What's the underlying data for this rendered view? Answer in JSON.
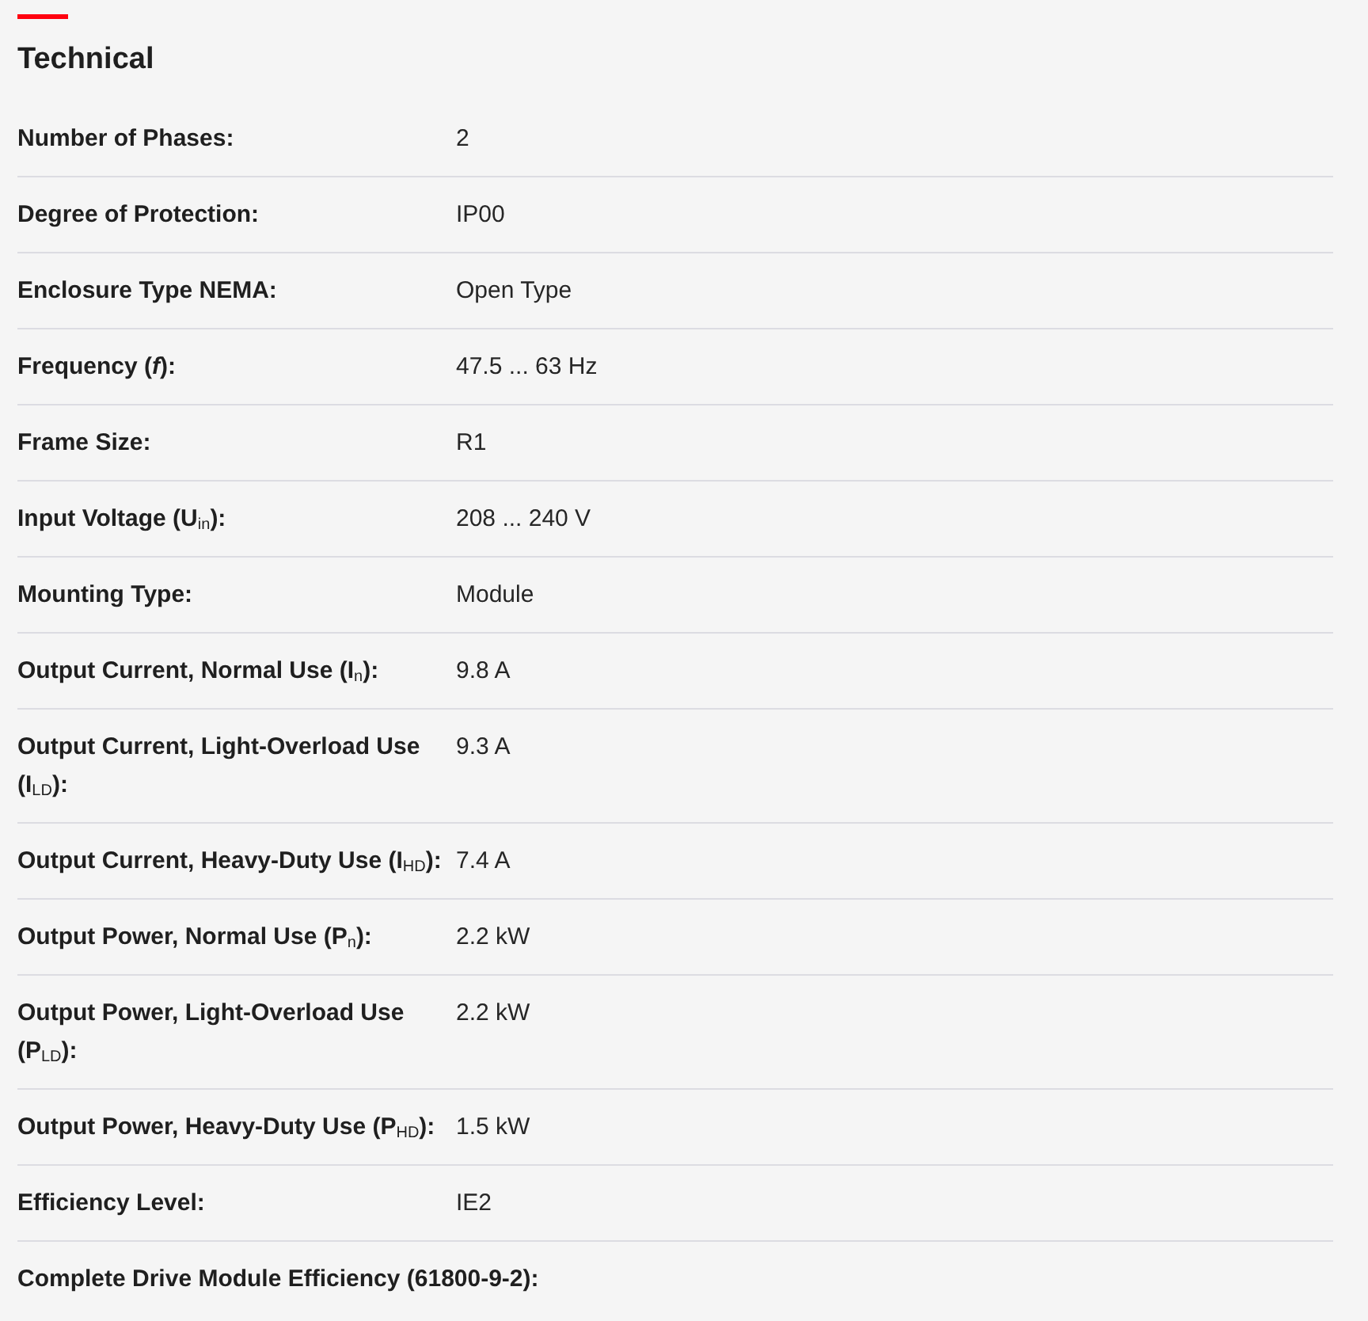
{
  "section": {
    "title": "Technical"
  },
  "rows": [
    {
      "kind": "pair",
      "label": "Number of Phases:",
      "value": "2"
    },
    {
      "kind": "pair",
      "label": "Degree of Protection:",
      "value": "IP00"
    },
    {
      "kind": "pair",
      "label": "Enclosure Type NEMA:",
      "value": "Open Type"
    },
    {
      "kind": "pair",
      "label": "Frequency (*f*):",
      "value": "47.5 ... 63 Hz"
    },
    {
      "kind": "pair",
      "label": "Frame Size:",
      "value": "R1"
    },
    {
      "kind": "pair",
      "label": "Input Voltage (U$_{in}$):",
      "value": "208 ... 240 V"
    },
    {
      "kind": "pair",
      "label": "Mounting Type:",
      "value": "Module"
    },
    {
      "kind": "pair",
      "label": "Output Current, Normal Use (I$_{n}$):",
      "value": "9.8 A"
    },
    {
      "kind": "pair",
      "label": "Output Current, Light-Overload Use (I$_{LD}$):",
      "value": "9.3 A"
    },
    {
      "kind": "pair",
      "label": "Output Current, Heavy-Duty Use (I$_{HD}$):",
      "value": "7.4 A"
    },
    {
      "kind": "pair",
      "label": "Output Power, Normal Use (P$_{n}$):",
      "value": "2.2 kW"
    },
    {
      "kind": "pair",
      "label": "Output Power, Light-Overload Use (P$_{LD}$):",
      "value": "2.2 kW"
    },
    {
      "kind": "pair",
      "label": "Output Power, Heavy-Duty Use (P$_{HD}$):",
      "value": "1.5 kW"
    },
    {
      "kind": "pair",
      "label": "Efficiency Level:",
      "value": "IE2"
    },
    {
      "kind": "heading",
      "label": "Complete Drive Module Efficiency (61800-9-2):"
    }
  ]
}
